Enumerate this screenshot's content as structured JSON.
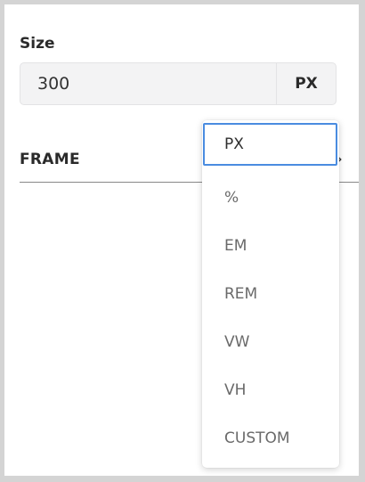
{
  "size": {
    "label": "Size",
    "value": "300",
    "unit": "PX"
  },
  "frame": {
    "label": "FRAME",
    "chevron_icon": "chevron-right-icon"
  },
  "unit_dropdown": {
    "selected": "PX",
    "options": [
      "PX",
      "%",
      "EM",
      "REM",
      "VW",
      "VH",
      "CUSTOM"
    ],
    "accent_color": "#4a8ce0"
  }
}
